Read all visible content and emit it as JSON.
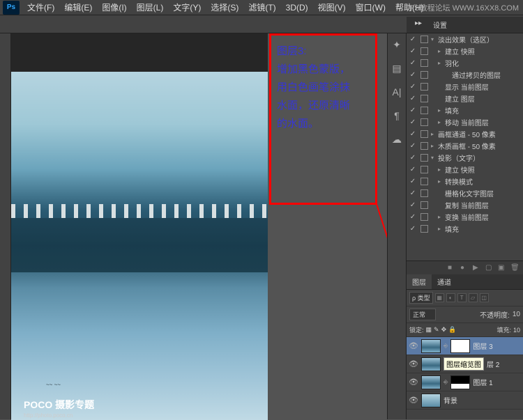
{
  "watermark": "PS教程论坛  WWW.16XX8.COM",
  "logo": "Ps",
  "menu": [
    "文件(F)",
    "编辑(E)",
    "图像(I)",
    "图层(L)",
    "文字(Y)",
    "选择(S)",
    "滤镜(T)",
    "3D(D)",
    "视图(V)",
    "窗口(W)",
    "帮助(H)"
  ],
  "annotation": {
    "title": "图层3:",
    "l1": "增加黑色蒙版，",
    "l2": "用白色画笔涂抹",
    "l3": "水面，还原清晰",
    "l4": "的水面。"
  },
  "poco": {
    "main": "POCO 摄影专题",
    "sub": "http://photo.poco.cn"
  },
  "panel_tab": "设置",
  "actions": [
    {
      "t": "淡出效果（选区）",
      "arrow": "▾"
    },
    {
      "t": "建立 快照",
      "arrow": "▸",
      "pad": 1
    },
    {
      "t": "羽化",
      "arrow": "▸",
      "pad": 1
    },
    {
      "t": "通过拷贝的图层",
      "pad": 2
    },
    {
      "t": "显示 当前图层",
      "pad": 1
    },
    {
      "t": "建立 图层",
      "pad": 1
    },
    {
      "t": "填充",
      "arrow": "▸",
      "pad": 1
    },
    {
      "t": "移动 当前图层",
      "arrow": "▸",
      "pad": 1
    },
    {
      "t": "画框通道 - 50 像素",
      "arrow": "▸"
    },
    {
      "t": "木质画框 - 50 像素",
      "arrow": "▸"
    },
    {
      "t": "投影（文字）",
      "arrow": "▾"
    },
    {
      "t": "建立 快照",
      "arrow": "▸",
      "pad": 1
    },
    {
      "t": "转换模式",
      "arrow": "▸",
      "pad": 1
    },
    {
      "t": "栅格化文字图层",
      "pad": 1
    },
    {
      "t": "复制 当前图层",
      "pad": 1
    },
    {
      "t": "变换 当前图层",
      "arrow": "▸",
      "pad": 1
    },
    {
      "t": "填充",
      "arrow": "▸",
      "pad": 1
    }
  ],
  "layers_panel": {
    "tabs": [
      "图层",
      "通道"
    ],
    "filter_label": "ρ 类型",
    "blend": "正常",
    "opacity_label": "不透明度:",
    "opacity": "10",
    "lock_label": "锁定:",
    "fill_label": "填充:",
    "fill": "10",
    "layers": [
      {
        "name": "图层 3",
        "sel": true,
        "mask": "white"
      },
      {
        "name": "图层缩览图",
        "tip": true,
        "suffix": "层 2"
      },
      {
        "name": "图层 1",
        "mask": "blackmask"
      },
      {
        "name": "背景",
        "bg": true
      }
    ]
  }
}
